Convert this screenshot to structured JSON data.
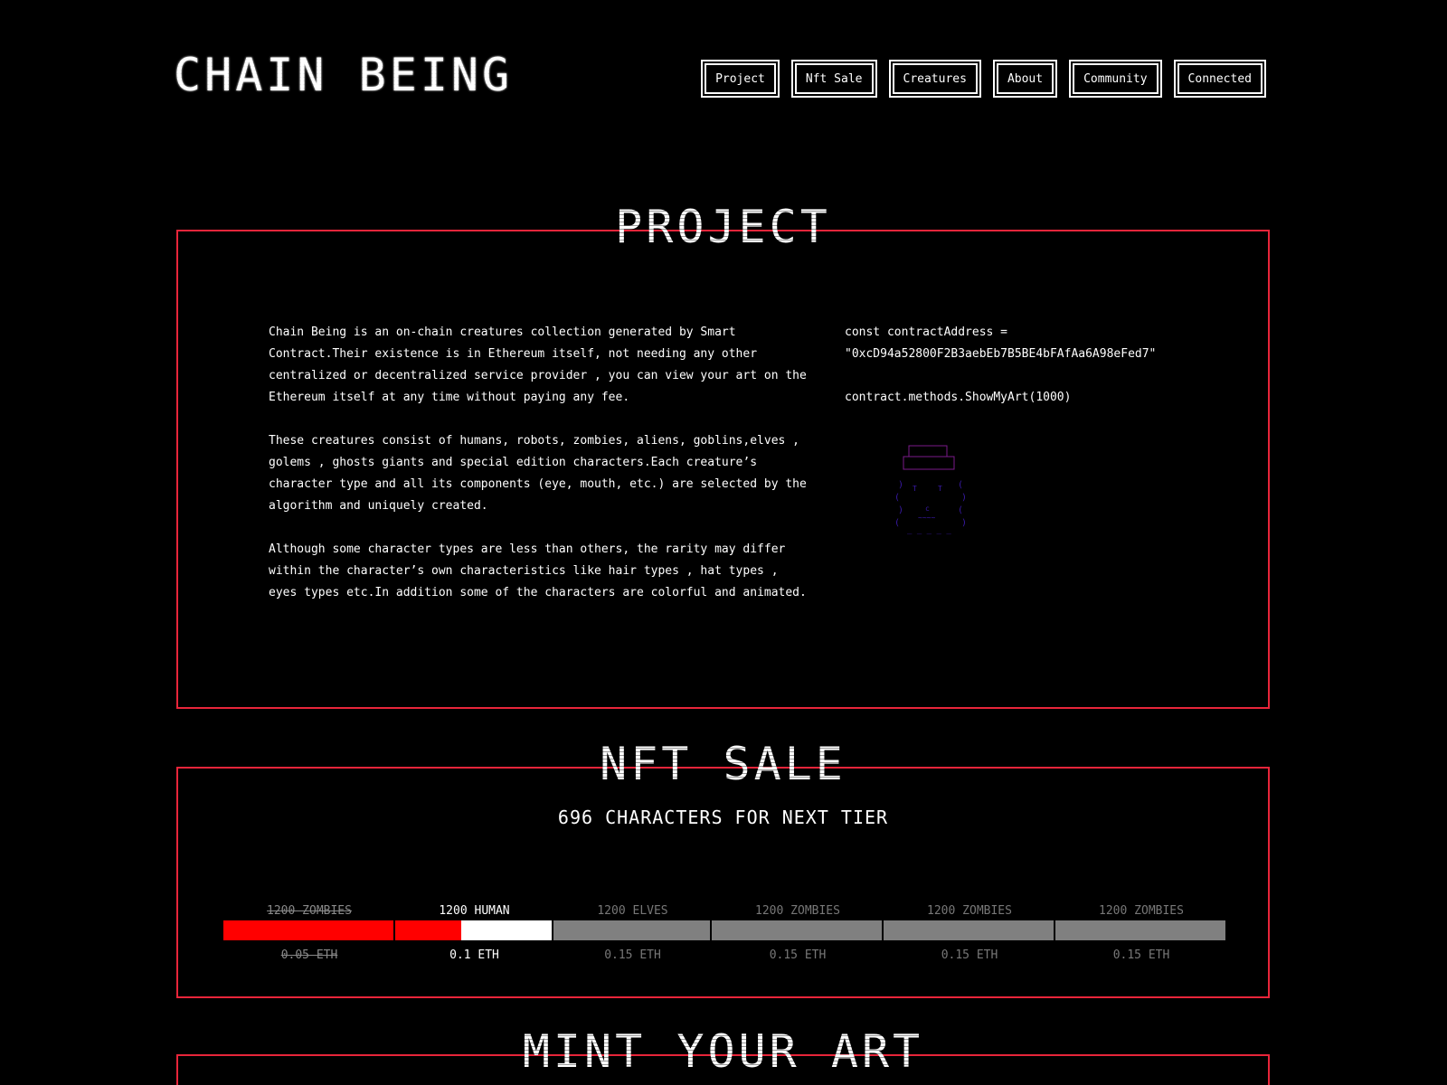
{
  "header": {
    "logo": "CHAIN BEING",
    "nav": [
      "Project",
      "Nft Sale",
      "Creatures",
      "About",
      "Community",
      "Connected"
    ]
  },
  "project": {
    "title": "PROJECT",
    "paragraphs": [
      "Chain Being is an on-chain creatures collection generated by Smart Contract.Their existence is in Ethereum itself, not needing any other centralized or decentralized service provider , you can view your art on the Ethereum itself at any time without paying any fee.",
      "These creatures consist of humans, robots, zombies, aliens, goblins,elves , golems , ghosts giants and special edition characters.Each creature’s character type and all its components (eye, mouth, etc.) are selected by the algorithm and uniquely created.",
      "Although some character types are less than others, the rarity may differ within the character’s own characteristics like hair types , hat types , eyes types etc.In addition some of the characters are colorful and animated."
    ],
    "code_line1": "const contractAddress =",
    "code_line2": "\"0xcD94a52800F2B3aebEb7B5BE4bFAfAa6A98eFed7\"",
    "code_line3": "contract.methods.ShowMyArt(1000)"
  },
  "nft_sale": {
    "title": "NFT SALE",
    "heading": "696 CHARACTERS FOR NEXT TIER",
    "tiers": [
      {
        "name": "1200 ZOMBIES",
        "price": "0.05 ETH",
        "state": "done",
        "progress": 1.0
      },
      {
        "name": "1200 HUMAN",
        "price": "0.1 ETH",
        "state": "current",
        "progress": 0.42
      },
      {
        "name": "1200 ELVES",
        "price": "0.15 ETH",
        "state": "upcoming",
        "progress": 0
      },
      {
        "name": "1200 ZOMBIES",
        "price": "0.15 ETH",
        "state": "upcoming",
        "progress": 0
      },
      {
        "name": "1200 ZOMBIES",
        "price": "0.15 ETH",
        "state": "upcoming",
        "progress": 0
      },
      {
        "name": "1200 ZOMBIES",
        "price": "0.15 ETH",
        "state": "upcoming",
        "progress": 0
      }
    ]
  },
  "mint": {
    "title": "MINT YOUR ART"
  },
  "colors": {
    "accent_border": "#e8253a",
    "progress_fill": "#ff0000",
    "creature_hat": "#7a1a8a",
    "creature_face": "#3a1aa8"
  }
}
